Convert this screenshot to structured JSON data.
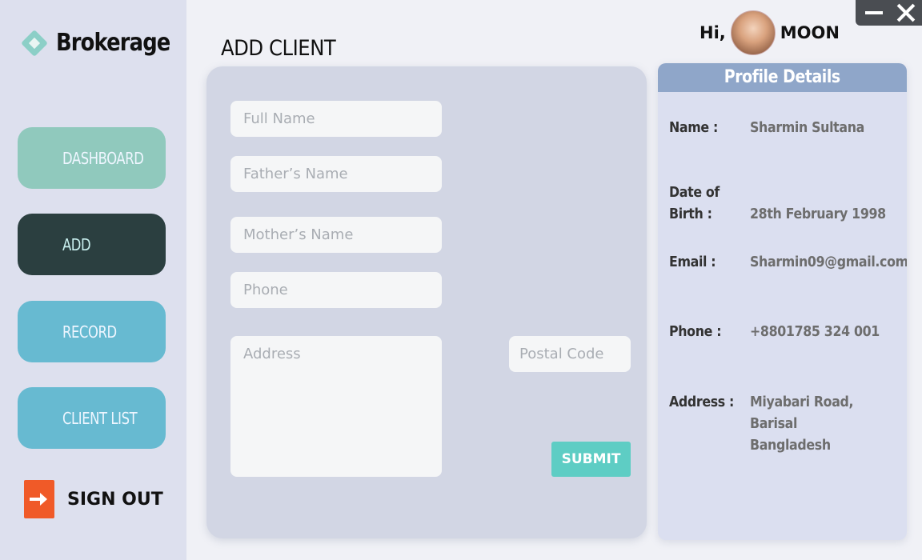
{
  "brand": {
    "name": "Brokerage"
  },
  "nav": {
    "dashboard": "DASHBOARD",
    "add": "ADD",
    "record": "RECORD",
    "client_list": "CLIENT LIST",
    "sign_out": "SIGN OUT"
  },
  "header": {
    "title": "ADD CLIENT",
    "greeting": "Hi,",
    "user_name": "MOON"
  },
  "form": {
    "full_name_placeholder": "Full Name",
    "father_name_placeholder": "Father’s Name",
    "mother_name_placeholder": "Mother’s Name",
    "phone_placeholder": "Phone",
    "address_placeholder": "Address",
    "postal_code_placeholder": "Postal Code",
    "submit_label": "SUBMIT"
  },
  "profile": {
    "heading": "Profile Details",
    "name_label": "Name :",
    "name_value": "Sharmin Sultana",
    "dob_label": "Date of\nBirth :",
    "dob_value": "28th February 1998",
    "email_label": "Email :",
    "email_value": "Sharmin09@gmail.com",
    "phone_label": "Phone :",
    "phone_value": "+8801785 324 001",
    "address_label": "Address :",
    "address_value": "Miyabari Road, Barisal\nBangladesh"
  },
  "colors": {
    "sidebar_bg": "#dde0ee",
    "dashboard_btn": "#90c9bd",
    "add_btn_active": "#2b3f40",
    "nav_btn": "#67bad1",
    "signout_icon": "#f05a28",
    "submit_btn": "#5ecdc4",
    "profile_header": "#8fa6c9"
  }
}
